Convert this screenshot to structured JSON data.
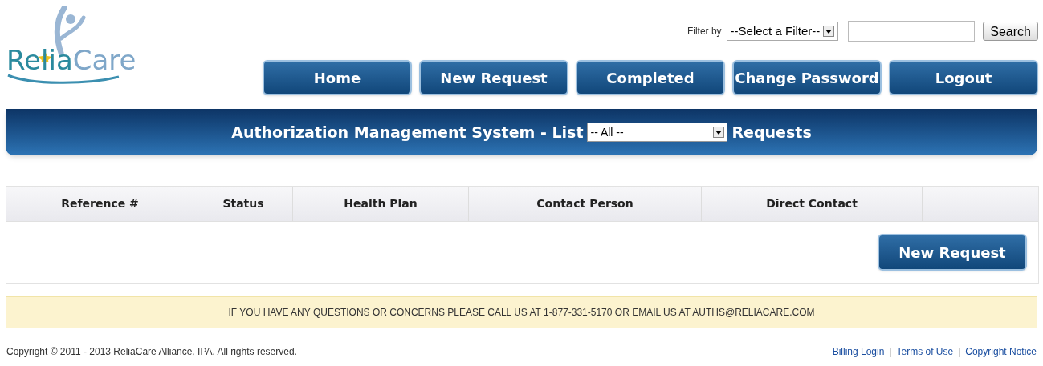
{
  "logo": {
    "text_1": "Relia",
    "text_2": "Care"
  },
  "filter": {
    "label": "Filter by",
    "select_value": "--Select a Filter--",
    "search_button": "Search"
  },
  "nav": [
    {
      "label": "Home"
    },
    {
      "label": "New Request"
    },
    {
      "label": "Completed"
    },
    {
      "label": "Change Password"
    },
    {
      "label": "Logout"
    }
  ],
  "banner": {
    "title": "Authorization Management System - List",
    "select_value": "-- All --",
    "suffix": "Requests"
  },
  "table": {
    "columns": [
      "Reference #",
      "Status",
      "Health Plan",
      "Contact Person",
      "Direct Contact"
    ],
    "button": "New Request"
  },
  "notice": "IF YOU HAVE ANY QUESTIONS OR CONCERNS PLEASE CALL US AT 1-877-331-5170 OR EMAIL US AT AUTHS@RELIACARE.COM",
  "footer": {
    "copyright": "Copyright © 2011 - 2013 ReliaCare Alliance, IPA. All rights reserved.",
    "items": [
      {
        "kind": "link",
        "text": "Billing Login"
      },
      {
        "kind": "separator",
        "text": "|"
      },
      {
        "kind": "link",
        "text": "Terms of Use"
      },
      {
        "kind": "separator",
        "text": "|"
      },
      {
        "kind": "link",
        "text": "Copyright Notice"
      }
    ]
  }
}
